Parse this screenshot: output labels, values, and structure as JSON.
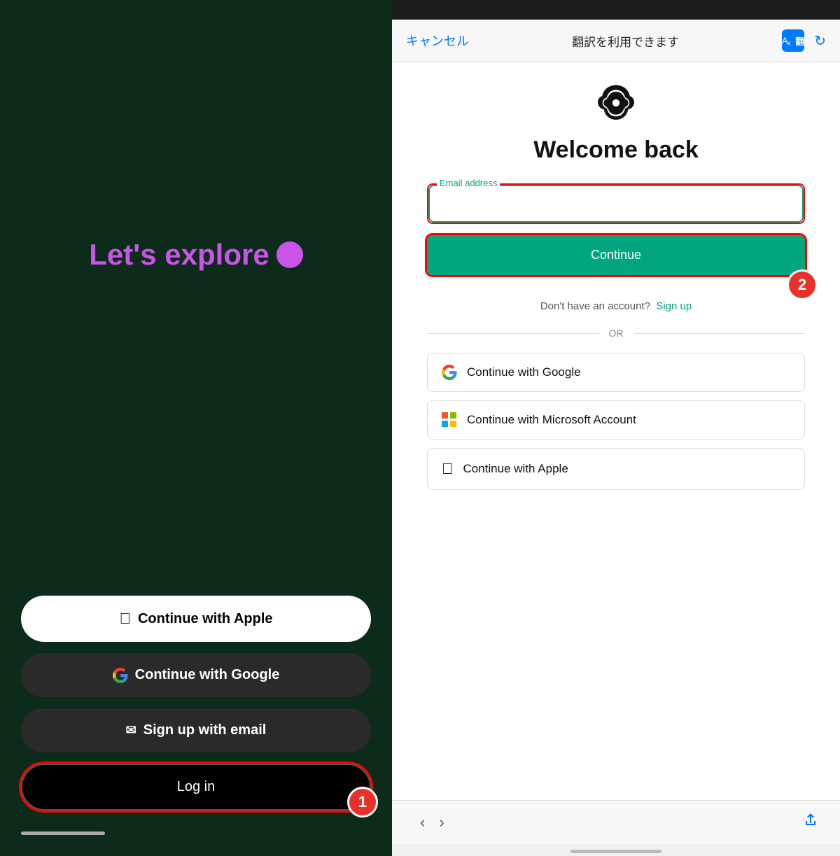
{
  "left": {
    "tagline": "Let's explore",
    "buttons": {
      "apple": "Continue with Apple",
      "google": "Continue with Google",
      "email": "Sign up with email",
      "login": "Log in"
    },
    "badge1": "1"
  },
  "right": {
    "browser": {
      "cancel": "キャンセル",
      "title": "翻訳を利用できます"
    },
    "welcome": "Welcome back",
    "email_label": "Email address",
    "email_placeholder": "",
    "continue_btn": "Continue",
    "no_account_text": "Don't have an account?",
    "signup_link": "Sign up",
    "or_text": "OR",
    "social_buttons": {
      "google": "Continue with Google",
      "microsoft": "Continue with Microsoft Account",
      "apple": "Continue with Apple"
    },
    "badge2": "2"
  }
}
